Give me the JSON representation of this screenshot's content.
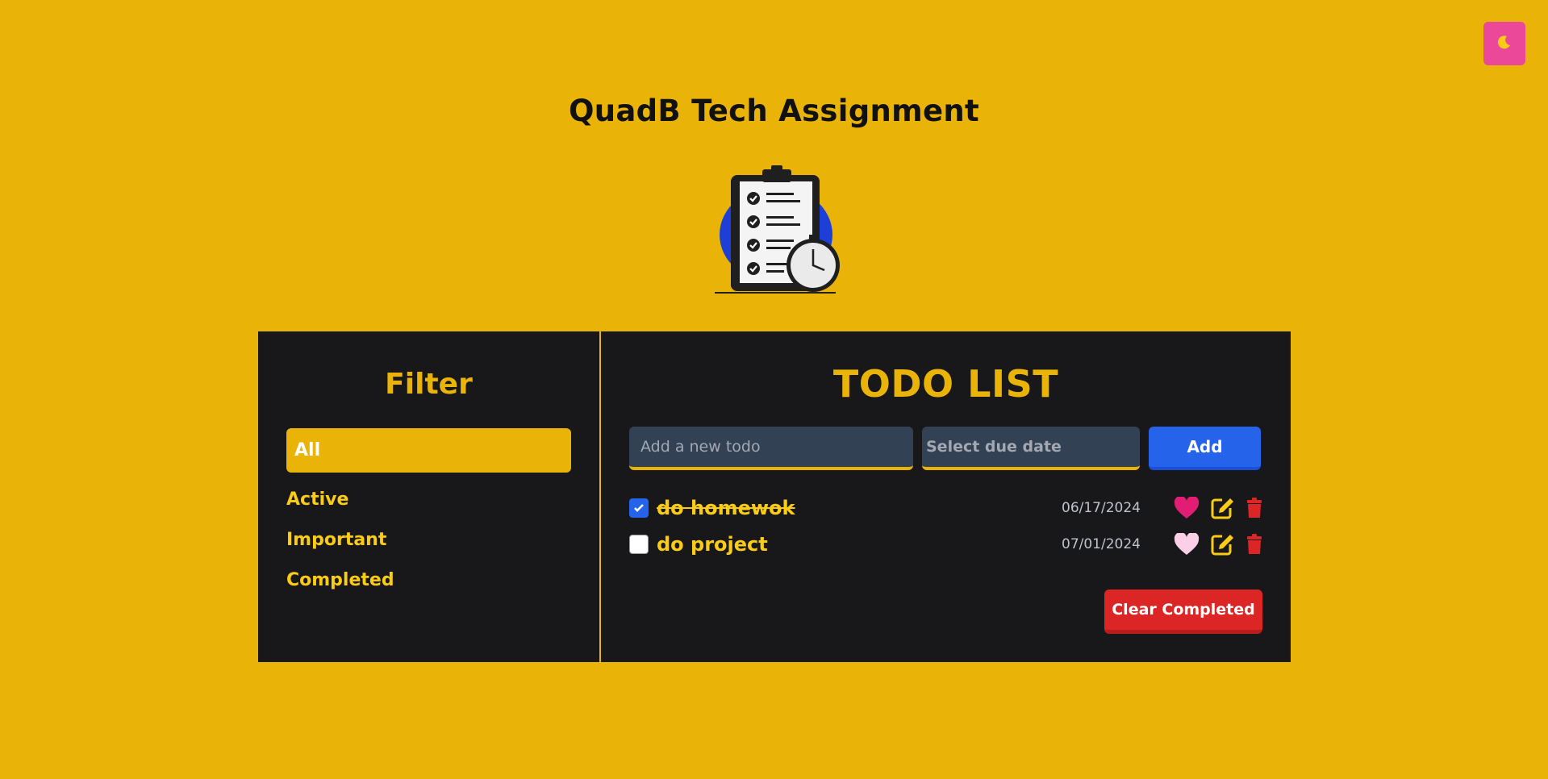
{
  "header": {
    "title": "QuadB Tech Assignment",
    "theme_toggle_icon": "moon-icon"
  },
  "sidebar": {
    "title": "Filter",
    "filters": [
      {
        "label": "All",
        "active": true
      },
      {
        "label": "Active",
        "active": false
      },
      {
        "label": "Important",
        "active": false
      },
      {
        "label": "Completed",
        "active": false
      }
    ]
  },
  "main": {
    "title": "TODO LIST",
    "todo_input_placeholder": "Add a new todo",
    "date_input_placeholder": "Select due date",
    "add_label": "Add",
    "todos": [
      {
        "text": "do homewok",
        "due": "06/17/2024",
        "completed": true,
        "important": true
      },
      {
        "text": "do project",
        "due": "07/01/2024",
        "completed": false,
        "important": false
      }
    ],
    "clear_label": "Clear Completed"
  },
  "colors": {
    "background": "#e9b308",
    "panel": "#18181b",
    "accent": "#facc15",
    "add_button": "#2563eb",
    "clear_button": "#dc2626",
    "theme_toggle": "#ec4899",
    "heart_important": "#e11d74",
    "heart_default": "#fbcfe8"
  }
}
